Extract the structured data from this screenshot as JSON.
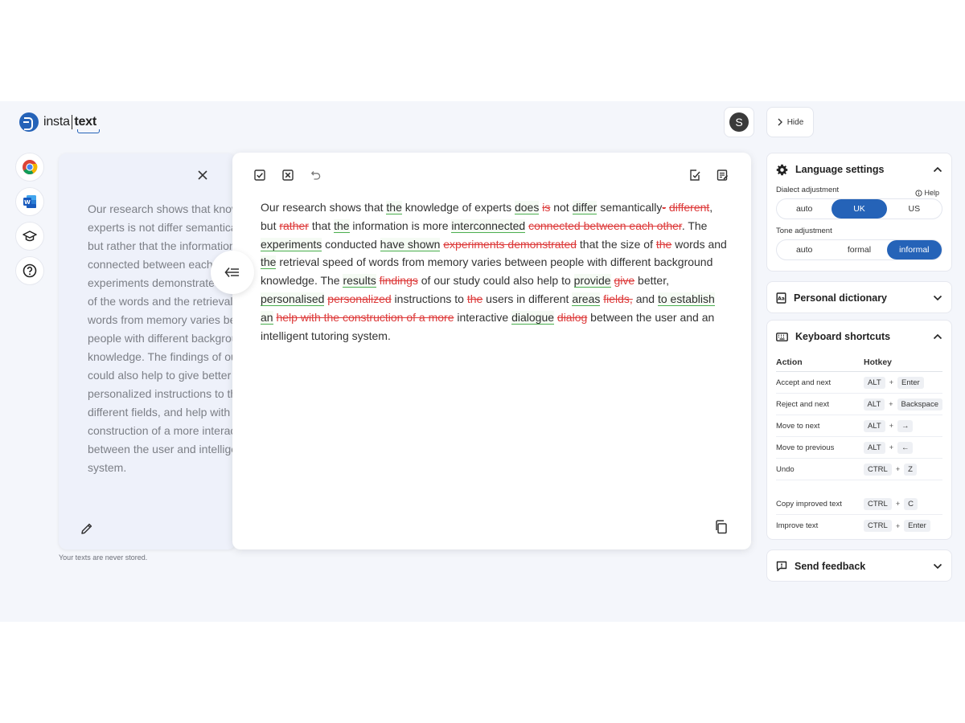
{
  "brand": {
    "left": "insta",
    "right": "text"
  },
  "header": {
    "avatar_initial": "S",
    "hide_label": "Hide"
  },
  "original": {
    "text": "Our research shows that knowledge of experts is not differ semantically different, but rather that the information is more connected between each other. The experiments demonstrated that the size of the words and the retrieval speed of words from memory varies between people with different background knowledge. The findings of our study could also help to give better personalized instructions to the users in different fields, and help with the construction of a more interactive dialog between the user and intelligent tutoring system.",
    "note": "Your texts are never stored."
  },
  "editor": {
    "segments": [
      {
        "t": "Our research shows that "
      },
      {
        "t": "the",
        "k": "ins"
      },
      {
        "t": " knowledge of experts "
      },
      {
        "t": "does",
        "k": "ins"
      },
      {
        "t": " "
      },
      {
        "t": "is",
        "k": "del"
      },
      {
        "t": " not "
      },
      {
        "t": "differ",
        "k": "ins"
      },
      {
        "t": " semantically"
      },
      {
        "t": "-",
        "k": "del"
      },
      {
        "t": " "
      },
      {
        "t": "different",
        "k": "del"
      },
      {
        "t": ", but "
      },
      {
        "t": "rather",
        "k": "del"
      },
      {
        "t": " that "
      },
      {
        "t": "the",
        "k": "ins"
      },
      {
        "t": " information is more "
      },
      {
        "t": "interconnected",
        "k": "ins"
      },
      {
        "t": " "
      },
      {
        "t": "connected between each other",
        "k": "del"
      },
      {
        "t": ". The "
      },
      {
        "t": "experiments",
        "k": "ins"
      },
      {
        "t": " conducted "
      },
      {
        "t": "have shown",
        "k": "ins"
      },
      {
        "t": " "
      },
      {
        "t": "experiments demonstrated",
        "k": "del"
      },
      {
        "t": " that the size of "
      },
      {
        "t": "the",
        "k": "del"
      },
      {
        "t": " words and "
      },
      {
        "t": "the",
        "k": "ins"
      },
      {
        "t": " retrieval speed of words from memory varies between people with different background knowledge. The "
      },
      {
        "t": "results",
        "k": "ins"
      },
      {
        "t": " "
      },
      {
        "t": "findings",
        "k": "del"
      },
      {
        "t": " of our study could also help to "
      },
      {
        "t": "provide",
        "k": "ins"
      },
      {
        "t": " "
      },
      {
        "t": "give",
        "k": "del"
      },
      {
        "t": " better, "
      },
      {
        "t": "personalised",
        "k": "ins"
      },
      {
        "t": " "
      },
      {
        "t": "personalized",
        "k": "del"
      },
      {
        "t": " instructions to "
      },
      {
        "t": "the",
        "k": "del"
      },
      {
        "t": " users in different "
      },
      {
        "t": "areas",
        "k": "ins"
      },
      {
        "t": " "
      },
      {
        "t": " fields,",
        "k": "del"
      },
      {
        "t": " and "
      },
      {
        "t": "to establish an",
        "k": "ins"
      },
      {
        "t": " "
      },
      {
        "t": "help with the construction of a more",
        "k": "del"
      },
      {
        "t": " interactive "
      },
      {
        "t": "dialogue",
        "k": "ins"
      },
      {
        "t": " "
      },
      {
        "t": "dialog",
        "k": "del"
      },
      {
        "t": " between the user and an intelligent tutoring system."
      }
    ]
  },
  "language_settings": {
    "title": "Language settings",
    "help_label": "Help",
    "dialect_label": "Dialect adjustment",
    "dialect_options": [
      "auto",
      "UK",
      "US"
    ],
    "dialect_selected": "UK",
    "tone_label": "Tone adjustment",
    "tone_options": [
      "auto",
      "formal",
      "informal"
    ],
    "tone_selected": "informal"
  },
  "personal_dictionary": {
    "title": "Personal dictionary"
  },
  "keyboard_shortcuts": {
    "title": "Keyboard shortcuts",
    "header": {
      "action": "Action",
      "hotkey": "Hotkey"
    },
    "rows": [
      {
        "action": "Accept and next",
        "keys": [
          "ALT",
          "Enter"
        ]
      },
      {
        "action": "Reject and next",
        "keys": [
          "ALT",
          "Backspace"
        ]
      },
      {
        "action": "Move to next",
        "keys": [
          "ALT",
          "→"
        ]
      },
      {
        "action": "Move to previous",
        "keys": [
          "ALT",
          "←"
        ]
      },
      {
        "action": "Undo",
        "keys": [
          "CTRL",
          "Z"
        ]
      },
      {
        "action": "Copy improved text",
        "keys": [
          "CTRL",
          "C"
        ]
      },
      {
        "action": "Improve text",
        "keys": [
          "CTRL",
          "Enter"
        ]
      }
    ]
  },
  "send_feedback": {
    "title": "Send feedback"
  }
}
